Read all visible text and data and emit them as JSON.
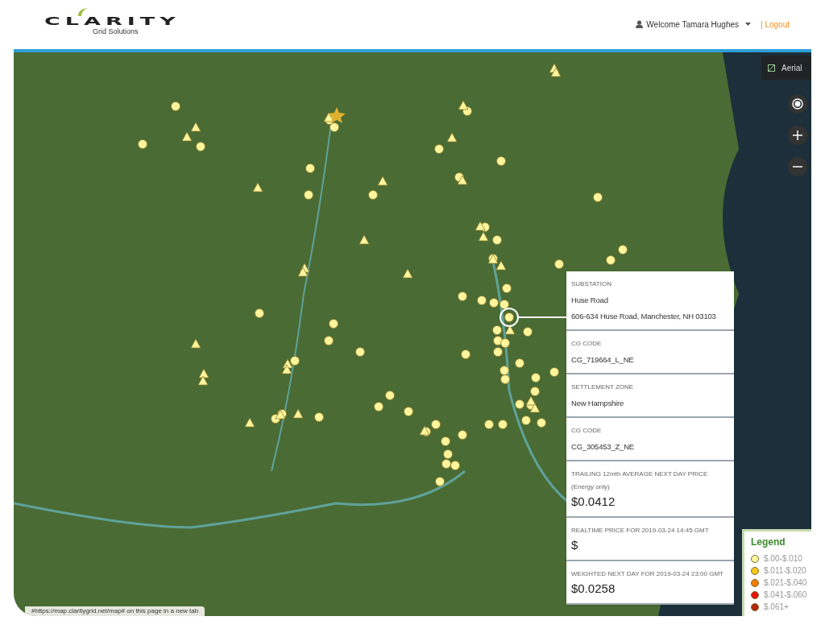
{
  "header": {
    "logo": {
      "name": "CLARITY",
      "tagline": "Grid Solutions"
    },
    "user_menu": "Welcome Tamara Hughes",
    "logout": "| Logout"
  },
  "map": {
    "layer_button": "Aerial",
    "link_tooltip": "#https://map.claritygrid.net/map# on this page in a new tab"
  },
  "popup": {
    "sections": [
      {
        "kind": "text",
        "label": "SUBSTATION",
        "lines": [
          "Huse Road",
          "606-634 Huse Road, Manchester, NH 03103"
        ]
      },
      {
        "kind": "text",
        "label": "CG CODE",
        "lines": [
          "CG_719664_L_NE"
        ]
      },
      {
        "kind": "text",
        "label": "SETTLEMENT ZONE",
        "lines": [
          "New Hampshire"
        ]
      },
      {
        "kind": "text",
        "label": "CG CODE",
        "lines": [
          "CG_305453_Z_NE"
        ]
      },
      {
        "kind": "price",
        "label": "TRAILING 12mth AVERAGE NEXT DAY PRICE (Energy only)",
        "value": "$0.0412"
      },
      {
        "kind": "price",
        "label": "REALTIME PRICE FOR 2019-03-24 14:45 GMT",
        "value": "$"
      },
      {
        "kind": "price",
        "label": "WEIGHTED NEXT DAY FOR 2019-03-24 23:00 GMT",
        "value": "$0.0258"
      }
    ]
  },
  "legend": {
    "title": "Legend",
    "items": [
      {
        "label": "$.00-$.010",
        "color": "#fff59d"
      },
      {
        "label": "$.011-$.020",
        "color": "#f5c518"
      },
      {
        "label": "$.021-$.040",
        "color": "#f57c00"
      },
      {
        "label": "$.041-$.060",
        "color": "#e8130f"
      },
      {
        "label": "$.061+",
        "color": "#b5260d"
      }
    ]
  }
}
